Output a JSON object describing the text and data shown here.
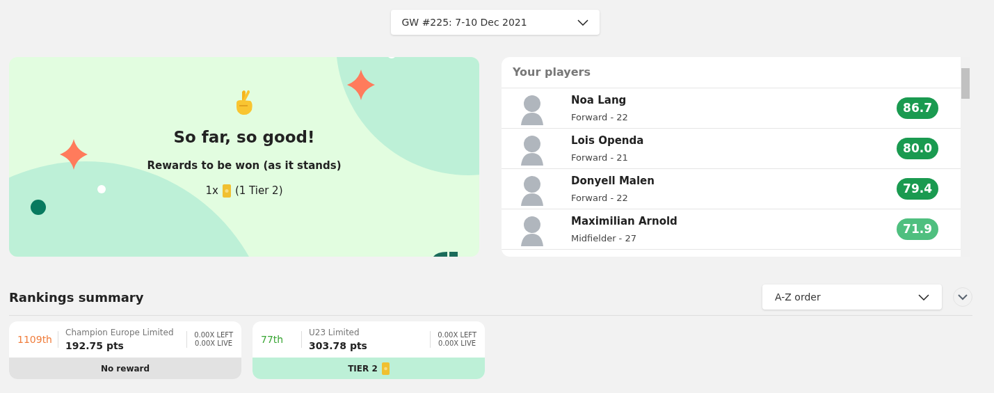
{
  "gameweek_select": {
    "value": "GW #225: 7-10 Dec 2021"
  },
  "result_card": {
    "title": "So far, so good!",
    "subtitle": "Rewards to be won (as it stands)",
    "reward_count": "1x",
    "reward_detail": "(1 Tier 2)"
  },
  "players_panel": {
    "title": "Your players",
    "players": [
      {
        "name": "Noa Lang",
        "detail": "Forward - 22",
        "score": "86.7",
        "color": "#1a9a50"
      },
      {
        "name": "Lois Openda",
        "detail": "Forward - 21",
        "score": "80.0",
        "color": "#1a9a50"
      },
      {
        "name": "Donyell Malen",
        "detail": "Forward - 22",
        "score": "79.4",
        "color": "#1a9a50"
      },
      {
        "name": "Maximilian Arnold",
        "detail": "Midfielder - 27",
        "score": "71.9",
        "color": "#4fbf7f"
      }
    ]
  },
  "rankings": {
    "title": "Rankings summary",
    "sort_select": {
      "value": "A-Z order"
    },
    "cards": [
      {
        "rank": "1109th",
        "color": "#f07d3c",
        "competition": "Champion Europe Limited",
        "points": "192.75 pts",
        "left": "0.00X LEFT",
        "live": "0.00X LIVE",
        "reward": "No reward",
        "kind": "none"
      },
      {
        "rank": "77th",
        "color": "#3aa635",
        "competition": "U23 Limited",
        "points": "303.78 pts",
        "left": "0.00X LEFT",
        "live": "0.00X LIVE",
        "reward": "TIER 2",
        "kind": "tier"
      }
    ]
  }
}
